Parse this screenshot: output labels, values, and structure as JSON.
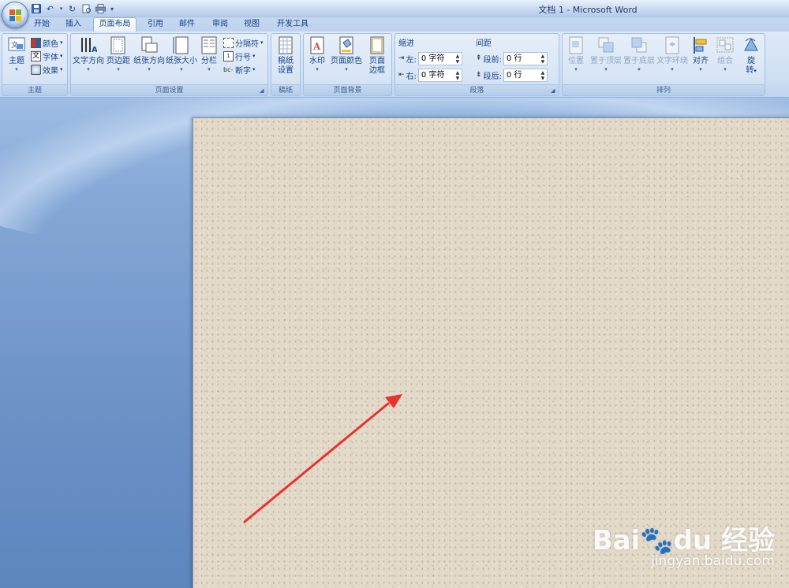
{
  "window": {
    "title": "文档 1 - Microsoft Word"
  },
  "quick_access": [
    {
      "name": "save-icon",
      "glyph": "💾"
    },
    {
      "name": "undo-icon",
      "glyph": "↶"
    },
    {
      "name": "redo-icon",
      "glyph": "↻"
    },
    {
      "name": "print-preview-icon",
      "glyph": "▣"
    },
    {
      "name": "print-icon",
      "glyph": "⎙"
    }
  ],
  "tabs": [
    "开始",
    "插入",
    "页面布局",
    "引用",
    "邮件",
    "审阅",
    "视图",
    "开发工具"
  ],
  "active_tab": "页面布局",
  "ribbon": {
    "theme": {
      "label": "主题",
      "big": "主题",
      "colors": "颜色",
      "fonts": "字体",
      "effects": "效果"
    },
    "page_setup": {
      "label": "页面设置",
      "text_direction": "文字方向",
      "margins": "页边距",
      "orientation": "纸张方向",
      "size": "纸张大小",
      "columns": "分栏",
      "breaks": "分隔符",
      "line_numbers": "行号",
      "hyphenation": "断字"
    },
    "draft_paper": {
      "label": "稿纸",
      "setup_line1": "稿纸",
      "setup_line2": "设置"
    },
    "page_background": {
      "label": "页面背景",
      "watermark": "水印",
      "page_color": "页面颜色",
      "page_borders_line1": "页面",
      "page_borders_line2": "边框"
    },
    "paragraph": {
      "label": "段落",
      "indent_title": "缩进",
      "spacing_title": "间距",
      "left_label": "左:",
      "left_value": "0 字符",
      "right_label": "右:",
      "right_value": "0 字符",
      "before_label": "段前:",
      "before_value": "0 行",
      "after_label": "段后:",
      "after_value": "0 行"
    },
    "arrange": {
      "label": "排列",
      "position": "位置",
      "bring_front": "置于顶层",
      "send_back": "置于底层",
      "text_wrap": "文字环绕",
      "align": "对齐",
      "group": "组合",
      "rotate_line1": "旋",
      "rotate_line2": "转"
    }
  },
  "colors": {
    "accent": "#15428b",
    "page_background": "#e3d9c9",
    "arrow": "#e8322e"
  },
  "watermark": {
    "logo_text": "Bai🐾du 经验",
    "url": "jingyan.baidu.com"
  }
}
